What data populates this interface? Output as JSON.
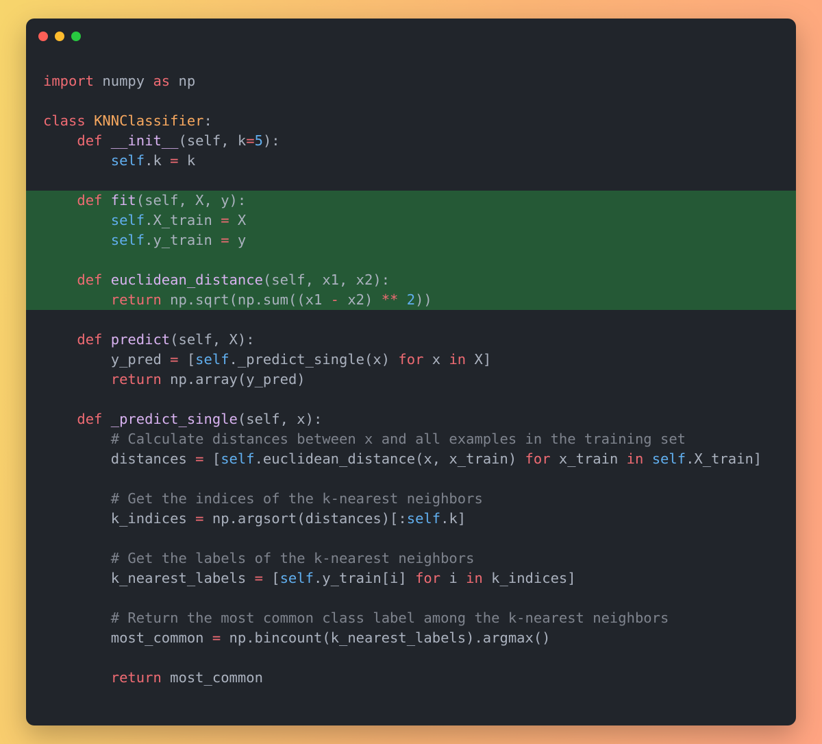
{
  "window": {
    "controls": [
      {
        "name": "close",
        "color": "#ff5f57"
      },
      {
        "name": "minimize",
        "color": "#febc2e"
      },
      {
        "name": "maximize",
        "color": "#28c840"
      }
    ]
  },
  "colors": {
    "keyword": "#ef6b73",
    "plain": "#abb2bf",
    "selfc": "#61afef",
    "funcname": "#d8b2f0",
    "classname": "#f7a85f",
    "number": "#61afef",
    "comment": "#7f848e",
    "operator": "#ef6b73",
    "highlight": "#255936"
  },
  "code_lines": [
    {
      "hl": false,
      "tokens": [
        [
          "keyword",
          "import"
        ],
        [
          "plain",
          " numpy "
        ],
        [
          "keyword",
          "as"
        ],
        [
          "plain",
          " np"
        ]
      ]
    },
    {
      "hl": false,
      "tokens": []
    },
    {
      "hl": false,
      "tokens": [
        [
          "keyword",
          "class"
        ],
        [
          "plain",
          " "
        ],
        [
          "classname",
          "KNNClassifier"
        ],
        [
          "plain",
          ":"
        ]
      ]
    },
    {
      "hl": false,
      "tokens": [
        [
          "plain",
          "    "
        ],
        [
          "keyword",
          "def"
        ],
        [
          "plain",
          " "
        ],
        [
          "funcname",
          "__init__"
        ],
        [
          "plain",
          "(self, k"
        ],
        [
          "operator",
          "="
        ],
        [
          "number",
          "5"
        ],
        [
          "plain",
          "):"
        ]
      ]
    },
    {
      "hl": false,
      "tokens": [
        [
          "plain",
          "        "
        ],
        [
          "selfc",
          "self"
        ],
        [
          "plain",
          ".k "
        ],
        [
          "operator",
          "="
        ],
        [
          "plain",
          " k"
        ]
      ]
    },
    {
      "hl": false,
      "tokens": []
    },
    {
      "hl": true,
      "tokens": [
        [
          "plain",
          "    "
        ],
        [
          "keyword",
          "def"
        ],
        [
          "plain",
          " "
        ],
        [
          "funcname",
          "fit"
        ],
        [
          "plain",
          "(self, X, y):"
        ]
      ]
    },
    {
      "hl": true,
      "tokens": [
        [
          "plain",
          "        "
        ],
        [
          "selfc",
          "self"
        ],
        [
          "plain",
          ".X_train "
        ],
        [
          "operator",
          "="
        ],
        [
          "plain",
          " X"
        ]
      ]
    },
    {
      "hl": true,
      "tokens": [
        [
          "plain",
          "        "
        ],
        [
          "selfc",
          "self"
        ],
        [
          "plain",
          ".y_train "
        ],
        [
          "operator",
          "="
        ],
        [
          "plain",
          " y"
        ]
      ]
    },
    {
      "hl": true,
      "tokens": []
    },
    {
      "hl": true,
      "tokens": [
        [
          "plain",
          "    "
        ],
        [
          "keyword",
          "def"
        ],
        [
          "plain",
          " "
        ],
        [
          "funcname",
          "euclidean_distance"
        ],
        [
          "plain",
          "(self, x1, x2):"
        ]
      ]
    },
    {
      "hl": true,
      "tokens": [
        [
          "plain",
          "        "
        ],
        [
          "keyword",
          "return"
        ],
        [
          "plain",
          " np.sqrt(np.sum((x1 "
        ],
        [
          "operator",
          "-"
        ],
        [
          "plain",
          " x2) "
        ],
        [
          "operator",
          "**"
        ],
        [
          "plain",
          " "
        ],
        [
          "number",
          "2"
        ],
        [
          "plain",
          "))"
        ]
      ]
    },
    {
      "hl": false,
      "tokens": []
    },
    {
      "hl": false,
      "tokens": [
        [
          "plain",
          "    "
        ],
        [
          "keyword",
          "def"
        ],
        [
          "plain",
          " "
        ],
        [
          "funcname",
          "predict"
        ],
        [
          "plain",
          "(self, X):"
        ]
      ]
    },
    {
      "hl": false,
      "tokens": [
        [
          "plain",
          "        y_pred "
        ],
        [
          "operator",
          "="
        ],
        [
          "plain",
          " ["
        ],
        [
          "selfc",
          "self"
        ],
        [
          "plain",
          "._predict_single(x) "
        ],
        [
          "keyword",
          "for"
        ],
        [
          "plain",
          " x "
        ],
        [
          "keyword",
          "in"
        ],
        [
          "plain",
          " X]"
        ]
      ]
    },
    {
      "hl": false,
      "tokens": [
        [
          "plain",
          "        "
        ],
        [
          "keyword",
          "return"
        ],
        [
          "plain",
          " np.array(y_pred)"
        ]
      ]
    },
    {
      "hl": false,
      "tokens": []
    },
    {
      "hl": false,
      "tokens": [
        [
          "plain",
          "    "
        ],
        [
          "keyword",
          "def"
        ],
        [
          "plain",
          " "
        ],
        [
          "funcname",
          "_predict_single"
        ],
        [
          "plain",
          "(self, x):"
        ]
      ]
    },
    {
      "hl": false,
      "tokens": [
        [
          "plain",
          "        "
        ],
        [
          "comment",
          "# Calculate distances between x and all examples in the training set"
        ]
      ]
    },
    {
      "hl": false,
      "tokens": [
        [
          "plain",
          "        distances "
        ],
        [
          "operator",
          "="
        ],
        [
          "plain",
          " ["
        ],
        [
          "selfc",
          "self"
        ],
        [
          "plain",
          ".euclidean_distance(x, x_train) "
        ],
        [
          "keyword",
          "for"
        ],
        [
          "plain",
          " x_train "
        ],
        [
          "keyword",
          "in"
        ],
        [
          "plain",
          " "
        ],
        [
          "selfc",
          "self"
        ],
        [
          "plain",
          ".X_train]"
        ]
      ]
    },
    {
      "hl": false,
      "tokens": []
    },
    {
      "hl": false,
      "tokens": [
        [
          "plain",
          "        "
        ],
        [
          "comment",
          "# Get the indices of the k-nearest neighbors"
        ]
      ]
    },
    {
      "hl": false,
      "tokens": [
        [
          "plain",
          "        k_indices "
        ],
        [
          "operator",
          "="
        ],
        [
          "plain",
          " np.argsort(distances)[:"
        ],
        [
          "selfc",
          "self"
        ],
        [
          "plain",
          ".k]"
        ]
      ]
    },
    {
      "hl": false,
      "tokens": []
    },
    {
      "hl": false,
      "tokens": [
        [
          "plain",
          "        "
        ],
        [
          "comment",
          "# Get the labels of the k-nearest neighbors"
        ]
      ]
    },
    {
      "hl": false,
      "tokens": [
        [
          "plain",
          "        k_nearest_labels "
        ],
        [
          "operator",
          "="
        ],
        [
          "plain",
          " ["
        ],
        [
          "selfc",
          "self"
        ],
        [
          "plain",
          ".y_train[i] "
        ],
        [
          "keyword",
          "for"
        ],
        [
          "plain",
          " i "
        ],
        [
          "keyword",
          "in"
        ],
        [
          "plain",
          " k_indices]"
        ]
      ]
    },
    {
      "hl": false,
      "tokens": []
    },
    {
      "hl": false,
      "tokens": [
        [
          "plain",
          "        "
        ],
        [
          "comment",
          "# Return the most common class label among the k-nearest neighbors"
        ]
      ]
    },
    {
      "hl": false,
      "tokens": [
        [
          "plain",
          "        most_common "
        ],
        [
          "operator",
          "="
        ],
        [
          "plain",
          " np.bincount(k_nearest_labels).argmax()"
        ]
      ]
    },
    {
      "hl": false,
      "tokens": []
    },
    {
      "hl": false,
      "tokens": [
        [
          "plain",
          "        "
        ],
        [
          "keyword",
          "return"
        ],
        [
          "plain",
          " most_common"
        ]
      ]
    }
  ]
}
